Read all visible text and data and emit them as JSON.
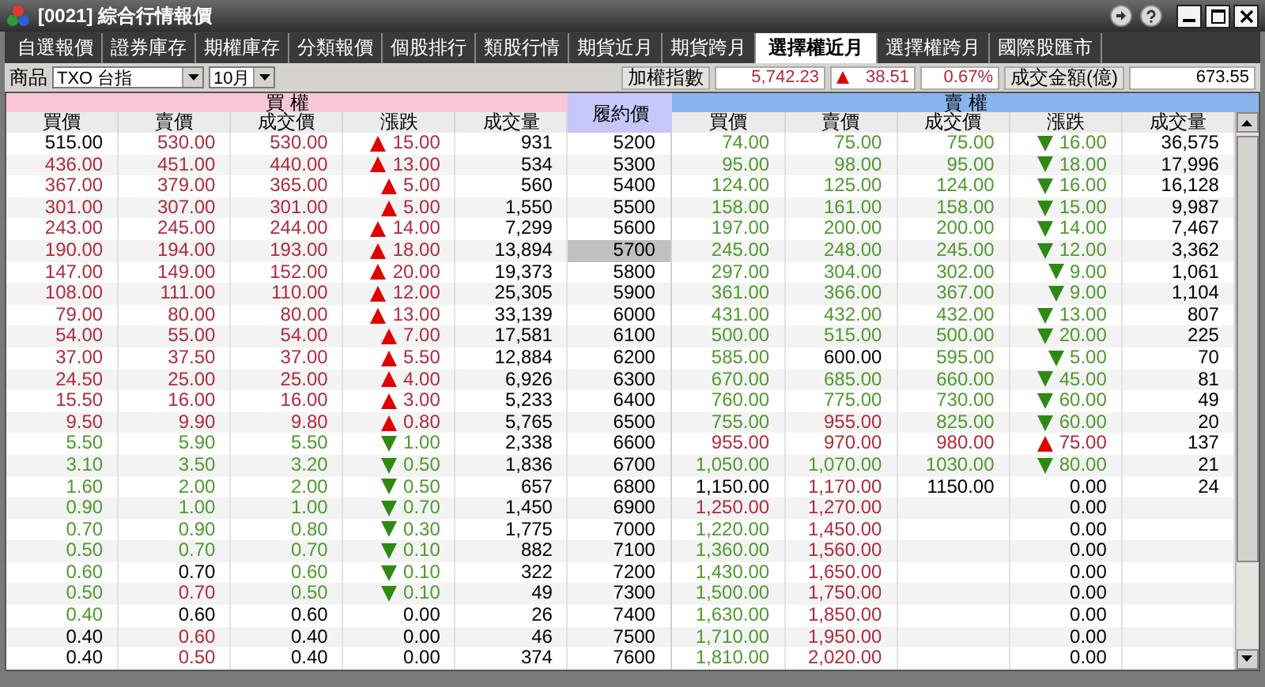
{
  "window": {
    "title": "[0021] 綜合行情報價"
  },
  "tabs": [
    {
      "label": "自選報價",
      "selected": false
    },
    {
      "label": "證券庫存",
      "selected": false
    },
    {
      "label": "期權庫存",
      "selected": false
    },
    {
      "label": "分類報價",
      "selected": false
    },
    {
      "label": "個股排行",
      "selected": false
    },
    {
      "label": "類股行情",
      "selected": false
    },
    {
      "label": "期貨近月",
      "selected": false
    },
    {
      "label": "期貨跨月",
      "selected": false
    },
    {
      "label": "選擇權近月",
      "selected": true
    },
    {
      "label": "選擇權跨月",
      "selected": false
    },
    {
      "label": "國際股匯市",
      "selected": false
    }
  ],
  "toolbar": {
    "product_label": "商品",
    "product": "TXO 台指",
    "month": "10月",
    "index_label": "加權指數",
    "index_value": "5,742.23",
    "index_change": {
      "text": "38.51",
      "kind": "up"
    },
    "index_percent": "0.67%",
    "turnover_label": "成交金額(億)",
    "turnover_value": "673.55"
  },
  "table": {
    "call_title": "買 權",
    "strike_title": "履約價",
    "put_title": "賣 權",
    "call_columns": [
      "買價",
      "賣價",
      "成交價",
      "漲跌",
      "成交量"
    ],
    "put_columns": [
      "買價",
      "賣價",
      "成交價",
      "漲跌",
      "成交量"
    ],
    "rows": [
      {
        "strike": "5200",
        "selected": false,
        "call": {
          "bid": {
            "text": "515.00",
            "color": "#000000"
          },
          "ask": {
            "text": "530.00",
            "color": "#b02a3c"
          },
          "last": {
            "text": "530.00",
            "color": "#b02a3c"
          },
          "change": {
            "text": "15.00",
            "kind": "up"
          },
          "volume": "931"
        },
        "put": {
          "bid": {
            "text": "74.00",
            "color": "#4d9a2c"
          },
          "ask": {
            "text": "75.00",
            "color": "#4d9a2c"
          },
          "last": {
            "text": "75.00",
            "color": "#4d9a2c"
          },
          "change": {
            "text": "16.00",
            "kind": "down"
          },
          "volume": "36,575"
        }
      },
      {
        "strike": "5300",
        "selected": false,
        "call": {
          "bid": {
            "text": "436.00",
            "color": "#b02a3c"
          },
          "ask": {
            "text": "451.00",
            "color": "#b02a3c"
          },
          "last": {
            "text": "440.00",
            "color": "#b02a3c"
          },
          "change": {
            "text": "13.00",
            "kind": "up"
          },
          "volume": "534"
        },
        "put": {
          "bid": {
            "text": "95.00",
            "color": "#4d9a2c"
          },
          "ask": {
            "text": "98.00",
            "color": "#4d9a2c"
          },
          "last": {
            "text": "95.00",
            "color": "#4d9a2c"
          },
          "change": {
            "text": "18.00",
            "kind": "down"
          },
          "volume": "17,996"
        }
      },
      {
        "strike": "5400",
        "selected": false,
        "call": {
          "bid": {
            "text": "367.00",
            "color": "#b02a3c"
          },
          "ask": {
            "text": "379.00",
            "color": "#b02a3c"
          },
          "last": {
            "text": "365.00",
            "color": "#b02a3c"
          },
          "change": {
            "text": "5.00",
            "kind": "up"
          },
          "volume": "560"
        },
        "put": {
          "bid": {
            "text": "124.00",
            "color": "#4d9a2c"
          },
          "ask": {
            "text": "125.00",
            "color": "#4d9a2c"
          },
          "last": {
            "text": "124.00",
            "color": "#4d9a2c"
          },
          "change": {
            "text": "16.00",
            "kind": "down"
          },
          "volume": "16,128"
        }
      },
      {
        "strike": "5500",
        "selected": false,
        "call": {
          "bid": {
            "text": "301.00",
            "color": "#b02a3c"
          },
          "ask": {
            "text": "307.00",
            "color": "#b02a3c"
          },
          "last": {
            "text": "301.00",
            "color": "#b02a3c"
          },
          "change": {
            "text": "5.00",
            "kind": "up"
          },
          "volume": "1,550"
        },
        "put": {
          "bid": {
            "text": "158.00",
            "color": "#4d9a2c"
          },
          "ask": {
            "text": "161.00",
            "color": "#4d9a2c"
          },
          "last": {
            "text": "158.00",
            "color": "#4d9a2c"
          },
          "change": {
            "text": "15.00",
            "kind": "down"
          },
          "volume": "9,987"
        }
      },
      {
        "strike": "5600",
        "selected": false,
        "call": {
          "bid": {
            "text": "243.00",
            "color": "#b02a3c"
          },
          "ask": {
            "text": "245.00",
            "color": "#b02a3c"
          },
          "last": {
            "text": "244.00",
            "color": "#b02a3c"
          },
          "change": {
            "text": "14.00",
            "kind": "up"
          },
          "volume": "7,299"
        },
        "put": {
          "bid": {
            "text": "197.00",
            "color": "#4d9a2c"
          },
          "ask": {
            "text": "200.00",
            "color": "#4d9a2c"
          },
          "last": {
            "text": "200.00",
            "color": "#4d9a2c"
          },
          "change": {
            "text": "14.00",
            "kind": "down"
          },
          "volume": "7,467"
        }
      },
      {
        "strike": "5700",
        "selected": true,
        "call": {
          "bid": {
            "text": "190.00",
            "color": "#b02a3c"
          },
          "ask": {
            "text": "194.00",
            "color": "#b02a3c"
          },
          "last": {
            "text": "193.00",
            "color": "#b02a3c"
          },
          "change": {
            "text": "18.00",
            "kind": "up"
          },
          "volume": "13,894"
        },
        "put": {
          "bid": {
            "text": "245.00",
            "color": "#4d9a2c"
          },
          "ask": {
            "text": "248.00",
            "color": "#4d9a2c"
          },
          "last": {
            "text": "245.00",
            "color": "#4d9a2c"
          },
          "change": {
            "text": "12.00",
            "kind": "down"
          },
          "volume": "3,362"
        }
      },
      {
        "strike": "5800",
        "selected": false,
        "call": {
          "bid": {
            "text": "147.00",
            "color": "#b02a3c"
          },
          "ask": {
            "text": "149.00",
            "color": "#b02a3c"
          },
          "last": {
            "text": "152.00",
            "color": "#b02a3c"
          },
          "change": {
            "text": "20.00",
            "kind": "up"
          },
          "volume": "19,373"
        },
        "put": {
          "bid": {
            "text": "297.00",
            "color": "#4d9a2c"
          },
          "ask": {
            "text": "304.00",
            "color": "#4d9a2c"
          },
          "last": {
            "text": "302.00",
            "color": "#4d9a2c"
          },
          "change": {
            "text": "9.00",
            "kind": "down"
          },
          "volume": "1,061"
        }
      },
      {
        "strike": "5900",
        "selected": false,
        "call": {
          "bid": {
            "text": "108.00",
            "color": "#b02a3c"
          },
          "ask": {
            "text": "111.00",
            "color": "#b02a3c"
          },
          "last": {
            "text": "110.00",
            "color": "#b02a3c"
          },
          "change": {
            "text": "12.00",
            "kind": "up"
          },
          "volume": "25,305"
        },
        "put": {
          "bid": {
            "text": "361.00",
            "color": "#4d9a2c"
          },
          "ask": {
            "text": "366.00",
            "color": "#4d9a2c"
          },
          "last": {
            "text": "367.00",
            "color": "#4d9a2c"
          },
          "change": {
            "text": "9.00",
            "kind": "down"
          },
          "volume": "1,104"
        }
      },
      {
        "strike": "6000",
        "selected": false,
        "call": {
          "bid": {
            "text": "79.00",
            "color": "#b02a3c"
          },
          "ask": {
            "text": "80.00",
            "color": "#b02a3c"
          },
          "last": {
            "text": "80.00",
            "color": "#b02a3c"
          },
          "change": {
            "text": "13.00",
            "kind": "up"
          },
          "volume": "33,139"
        },
        "put": {
          "bid": {
            "text": "431.00",
            "color": "#4d9a2c"
          },
          "ask": {
            "text": "432.00",
            "color": "#4d9a2c"
          },
          "last": {
            "text": "432.00",
            "color": "#4d9a2c"
          },
          "change": {
            "text": "13.00",
            "kind": "down"
          },
          "volume": "807"
        }
      },
      {
        "strike": "6100",
        "selected": false,
        "call": {
          "bid": {
            "text": "54.00",
            "color": "#b02a3c"
          },
          "ask": {
            "text": "55.00",
            "color": "#b02a3c"
          },
          "last": {
            "text": "54.00",
            "color": "#b02a3c"
          },
          "change": {
            "text": "7.00",
            "kind": "up"
          },
          "volume": "17,581"
        },
        "put": {
          "bid": {
            "text": "500.00",
            "color": "#4d9a2c"
          },
          "ask": {
            "text": "515.00",
            "color": "#4d9a2c"
          },
          "last": {
            "text": "500.00",
            "color": "#4d9a2c"
          },
          "change": {
            "text": "20.00",
            "kind": "down"
          },
          "volume": "225"
        }
      },
      {
        "strike": "6200",
        "selected": false,
        "call": {
          "bid": {
            "text": "37.00",
            "color": "#b02a3c"
          },
          "ask": {
            "text": "37.50",
            "color": "#b02a3c"
          },
          "last": {
            "text": "37.00",
            "color": "#b02a3c"
          },
          "change": {
            "text": "5.50",
            "kind": "up"
          },
          "volume": "12,884"
        },
        "put": {
          "bid": {
            "text": "585.00",
            "color": "#4d9a2c"
          },
          "ask": {
            "text": "600.00",
            "color": "#000000"
          },
          "last": {
            "text": "595.00",
            "color": "#4d9a2c"
          },
          "change": {
            "text": "5.00",
            "kind": "down"
          },
          "volume": "70"
        }
      },
      {
        "strike": "6300",
        "selected": false,
        "call": {
          "bid": {
            "text": "24.50",
            "color": "#b02a3c"
          },
          "ask": {
            "text": "25.00",
            "color": "#b02a3c"
          },
          "last": {
            "text": "25.00",
            "color": "#b02a3c"
          },
          "change": {
            "text": "4.00",
            "kind": "up"
          },
          "volume": "6,926"
        },
        "put": {
          "bid": {
            "text": "670.00",
            "color": "#4d9a2c"
          },
          "ask": {
            "text": "685.00",
            "color": "#4d9a2c"
          },
          "last": {
            "text": "660.00",
            "color": "#4d9a2c"
          },
          "change": {
            "text": "45.00",
            "kind": "down"
          },
          "volume": "81"
        }
      },
      {
        "strike": "6400",
        "selected": false,
        "call": {
          "bid": {
            "text": "15.50",
            "color": "#b02a3c"
          },
          "ask": {
            "text": "16.00",
            "color": "#b02a3c"
          },
          "last": {
            "text": "16.00",
            "color": "#b02a3c"
          },
          "change": {
            "text": "3.00",
            "kind": "up"
          },
          "volume": "5,233"
        },
        "put": {
          "bid": {
            "text": "760.00",
            "color": "#4d9a2c"
          },
          "ask": {
            "text": "775.00",
            "color": "#4d9a2c"
          },
          "last": {
            "text": "730.00",
            "color": "#4d9a2c"
          },
          "change": {
            "text": "60.00",
            "kind": "down"
          },
          "volume": "49"
        }
      },
      {
        "strike": "6500",
        "selected": false,
        "call": {
          "bid": {
            "text": "9.50",
            "color": "#b02a3c"
          },
          "ask": {
            "text": "9.90",
            "color": "#b02a3c"
          },
          "last": {
            "text": "9.80",
            "color": "#b02a3c"
          },
          "change": {
            "text": "0.80",
            "kind": "up"
          },
          "volume": "5,765"
        },
        "put": {
          "bid": {
            "text": "755.00",
            "color": "#4d9a2c"
          },
          "ask": {
            "text": "955.00",
            "color": "#b02a3c"
          },
          "last": {
            "text": "825.00",
            "color": "#4d9a2c"
          },
          "change": {
            "text": "60.00",
            "kind": "down"
          },
          "volume": "20"
        }
      },
      {
        "strike": "6600",
        "selected": false,
        "call": {
          "bid": {
            "text": "5.50",
            "color": "#4d9a2c"
          },
          "ask": {
            "text": "5.90",
            "color": "#4d9a2c"
          },
          "last": {
            "text": "5.50",
            "color": "#4d9a2c"
          },
          "change": {
            "text": "1.00",
            "kind": "down"
          },
          "volume": "2,338"
        },
        "put": {
          "bid": {
            "text": "955.00",
            "color": "#b02a3c"
          },
          "ask": {
            "text": "970.00",
            "color": "#b02a3c"
          },
          "last": {
            "text": "980.00",
            "color": "#b02a3c"
          },
          "change": {
            "text": "75.00",
            "kind": "up"
          },
          "volume": "137"
        }
      },
      {
        "strike": "6700",
        "selected": false,
        "call": {
          "bid": {
            "text": "3.10",
            "color": "#4d9a2c"
          },
          "ask": {
            "text": "3.50",
            "color": "#4d9a2c"
          },
          "last": {
            "text": "3.20",
            "color": "#4d9a2c"
          },
          "change": {
            "text": "0.50",
            "kind": "down"
          },
          "volume": "1,836"
        },
        "put": {
          "bid": {
            "text": "1,050.00",
            "color": "#4d9a2c"
          },
          "ask": {
            "text": "1,070.00",
            "color": "#4d9a2c"
          },
          "last": {
            "text": "1030.00",
            "color": "#4d9a2c"
          },
          "change": {
            "text": "80.00",
            "kind": "down"
          },
          "volume": "21"
        }
      },
      {
        "strike": "6800",
        "selected": false,
        "call": {
          "bid": {
            "text": "1.60",
            "color": "#4d9a2c"
          },
          "ask": {
            "text": "2.00",
            "color": "#4d9a2c"
          },
          "last": {
            "text": "2.00",
            "color": "#4d9a2c"
          },
          "change": {
            "text": "0.50",
            "kind": "down"
          },
          "volume": "657"
        },
        "put": {
          "bid": {
            "text": "1,150.00",
            "color": "#000000"
          },
          "ask": {
            "text": "1,170.00",
            "color": "#b02a3c"
          },
          "last": {
            "text": "1150.00",
            "color": "#000000"
          },
          "change": {
            "text": "0.00",
            "kind": "flat"
          },
          "volume": "24"
        }
      },
      {
        "strike": "6900",
        "selected": false,
        "call": {
          "bid": {
            "text": "0.90",
            "color": "#4d9a2c"
          },
          "ask": {
            "text": "1.00",
            "color": "#4d9a2c"
          },
          "last": {
            "text": "1.00",
            "color": "#4d9a2c"
          },
          "change": {
            "text": "0.70",
            "kind": "down"
          },
          "volume": "1,450"
        },
        "put": {
          "bid": {
            "text": "1,250.00",
            "color": "#b02a3c"
          },
          "ask": {
            "text": "1,270.00",
            "color": "#b02a3c"
          },
          "change": {
            "text": "0.00",
            "kind": "flat"
          }
        }
      },
      {
        "strike": "7000",
        "selected": false,
        "call": {
          "bid": {
            "text": "0.70",
            "color": "#4d9a2c"
          },
          "ask": {
            "text": "0.90",
            "color": "#4d9a2c"
          },
          "last": {
            "text": "0.80",
            "color": "#4d9a2c"
          },
          "change": {
            "text": "0.30",
            "kind": "down"
          },
          "volume": "1,775"
        },
        "put": {
          "bid": {
            "text": "1,220.00",
            "color": "#4d9a2c"
          },
          "ask": {
            "text": "1,450.00",
            "color": "#b02a3c"
          },
          "change": {
            "text": "0.00",
            "kind": "flat"
          }
        }
      },
      {
        "strike": "7100",
        "selected": false,
        "call": {
          "bid": {
            "text": "0.50",
            "color": "#4d9a2c"
          },
          "ask": {
            "text": "0.70",
            "color": "#4d9a2c"
          },
          "last": {
            "text": "0.70",
            "color": "#4d9a2c"
          },
          "change": {
            "text": "0.10",
            "kind": "down"
          },
          "volume": "882"
        },
        "put": {
          "bid": {
            "text": "1,360.00",
            "color": "#4d9a2c"
          },
          "ask": {
            "text": "1,560.00",
            "color": "#b02a3c"
          },
          "change": {
            "text": "0.00",
            "kind": "flat"
          }
        }
      },
      {
        "strike": "7200",
        "selected": false,
        "call": {
          "bid": {
            "text": "0.60",
            "color": "#4d9a2c"
          },
          "ask": {
            "text": "0.70",
            "color": "#000000"
          },
          "last": {
            "text": "0.60",
            "color": "#4d9a2c"
          },
          "change": {
            "text": "0.10",
            "kind": "down"
          },
          "volume": "322"
        },
        "put": {
          "bid": {
            "text": "1,430.00",
            "color": "#4d9a2c"
          },
          "ask": {
            "text": "1,650.00",
            "color": "#b02a3c"
          },
          "change": {
            "text": "0.00",
            "kind": "flat"
          }
        }
      },
      {
        "strike": "7300",
        "selected": false,
        "call": {
          "bid": {
            "text": "0.50",
            "color": "#4d9a2c"
          },
          "ask": {
            "text": "0.70",
            "color": "#b02a3c"
          },
          "last": {
            "text": "0.50",
            "color": "#4d9a2c"
          },
          "change": {
            "text": "0.10",
            "kind": "down"
          },
          "volume": "49"
        },
        "put": {
          "bid": {
            "text": "1,500.00",
            "color": "#4d9a2c"
          },
          "ask": {
            "text": "1,750.00",
            "color": "#b02a3c"
          },
          "change": {
            "text": "0.00",
            "kind": "flat"
          }
        }
      },
      {
        "strike": "7400",
        "selected": false,
        "call": {
          "bid": {
            "text": "0.40",
            "color": "#4d9a2c"
          },
          "ask": {
            "text": "0.60",
            "color": "#000000"
          },
          "last": {
            "text": "0.60",
            "color": "#000000"
          },
          "change": {
            "text": "0.00",
            "kind": "flat"
          },
          "volume": "26"
        },
        "put": {
          "bid": {
            "text": "1,630.00",
            "color": "#4d9a2c"
          },
          "ask": {
            "text": "1,850.00",
            "color": "#b02a3c"
          },
          "change": {
            "text": "0.00",
            "kind": "flat"
          }
        }
      },
      {
        "strike": "7500",
        "selected": false,
        "call": {
          "bid": {
            "text": "0.40",
            "color": "#000000"
          },
          "ask": {
            "text": "0.60",
            "color": "#b02a3c"
          },
          "last": {
            "text": "0.40",
            "color": "#000000"
          },
          "change": {
            "text": "0.00",
            "kind": "flat"
          },
          "volume": "46"
        },
        "put": {
          "bid": {
            "text": "1,710.00",
            "color": "#4d9a2c"
          },
          "ask": {
            "text": "1,950.00",
            "color": "#b02a3c"
          },
          "change": {
            "text": "0.00",
            "kind": "flat"
          }
        }
      },
      {
        "strike": "7600",
        "selected": false,
        "call": {
          "bid": {
            "text": "0.40",
            "color": "#000000"
          },
          "ask": {
            "text": "0.50",
            "color": "#b02a3c"
          },
          "last": {
            "text": "0.40",
            "color": "#000000"
          },
          "change": {
            "text": "0.00",
            "kind": "flat"
          },
          "volume": "374"
        },
        "put": {
          "bid": {
            "text": "1,810.00",
            "color": "#4d9a2c"
          },
          "ask": {
            "text": "2,020.00",
            "color": "#b02a3c"
          },
          "change": {
            "text": "0.00",
            "kind": "flat"
          }
        }
      }
    ]
  }
}
